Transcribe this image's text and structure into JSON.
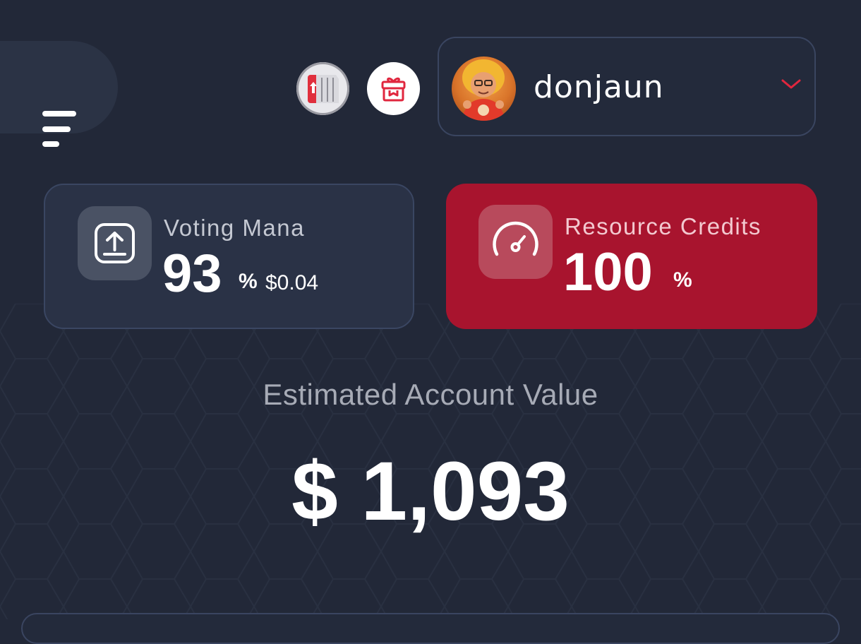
{
  "header": {
    "menu_icon": "hamburger-menu-icon",
    "wallet_icon": "wallet-box-icon",
    "gift_icon": "gift-icon",
    "account": {
      "username": "donjaun",
      "dropdown_icon": "chevron-down-icon"
    }
  },
  "cards": {
    "voting_mana": {
      "label": "Voting Mana",
      "value": "93",
      "unit": "%",
      "usd": "$0.04",
      "icon": "upload-tray-icon"
    },
    "resource_credits": {
      "label": "Resource Credits",
      "value": "100",
      "unit": "%",
      "icon": "speedometer-icon"
    }
  },
  "estimate": {
    "label": "Estimated Account Value",
    "value": "$ 1,093"
  },
  "colors": {
    "background": "#222838",
    "card": "#2a3246",
    "accent_red": "#a8142e",
    "muted_text": "#a7abb6"
  }
}
